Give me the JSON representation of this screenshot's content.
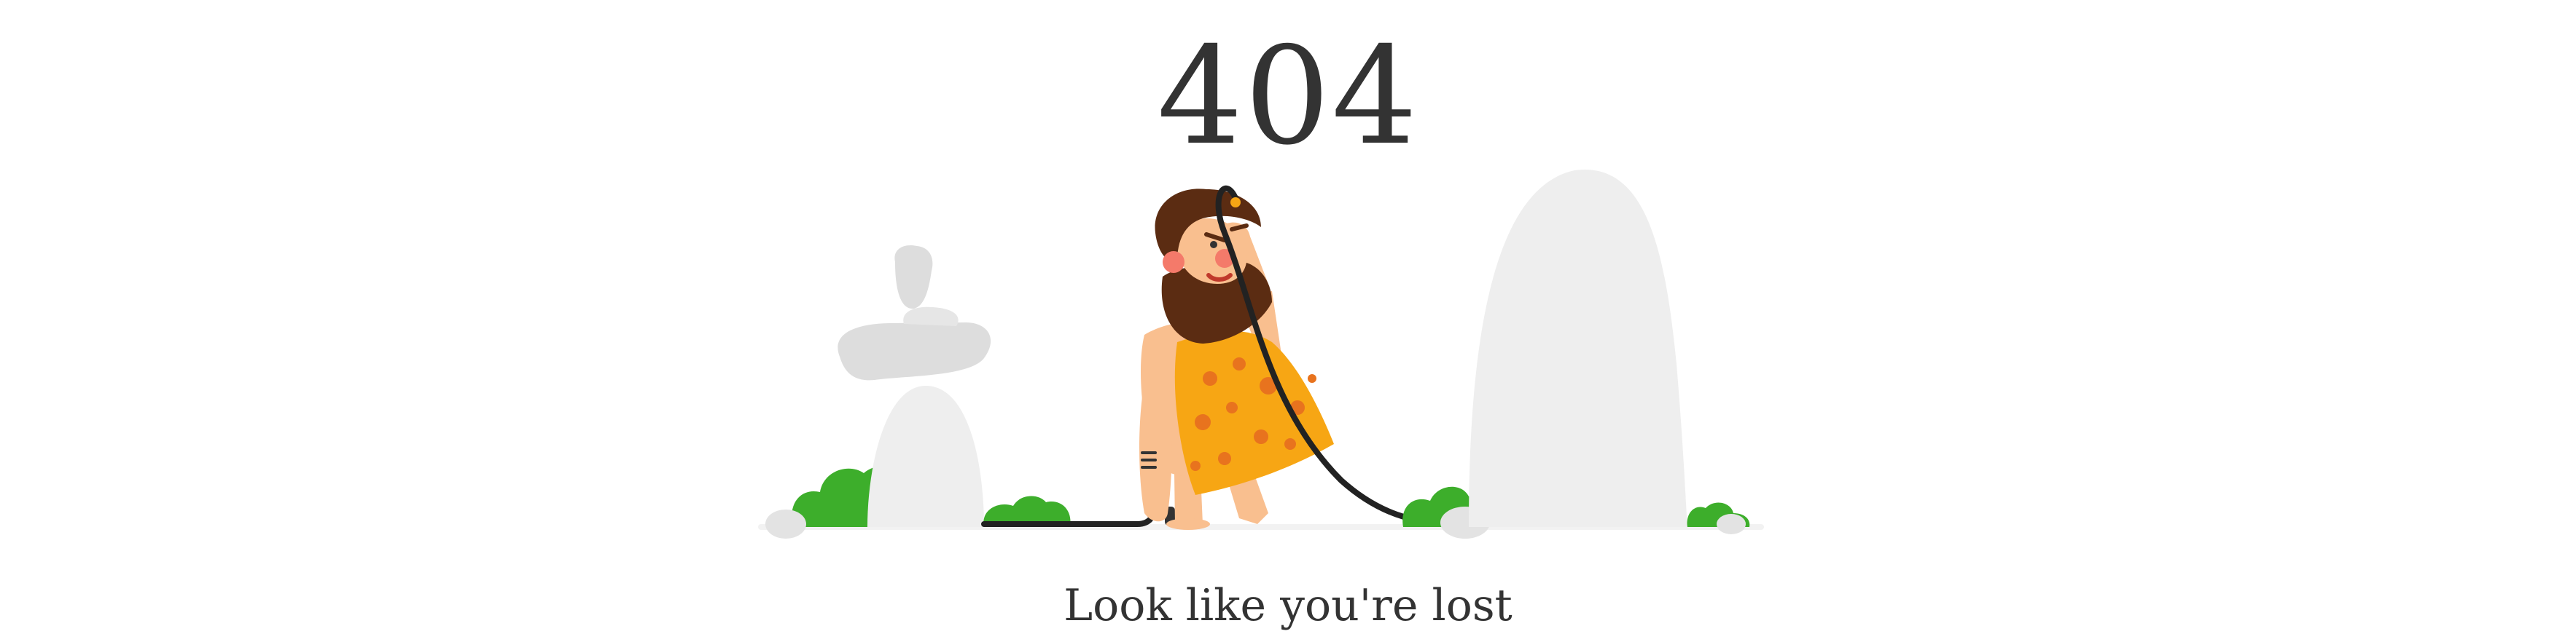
{
  "error_page": {
    "code": "404",
    "message": "Look like you're lost"
  },
  "illustration": {
    "subject": "caveman-holding-cable",
    "colors": {
      "stone_light": "#EEEEEE",
      "stone_mid": "#DDDDDD",
      "bush": "#3DAE2B",
      "skin": "#F9BF8F",
      "hair": "#5B2C12",
      "loincloth": "#F7A614",
      "spots": "#E8731E",
      "cable": "#222222",
      "ground": "#F2F2F2"
    },
    "icons": [
      "stone-cairn-icon",
      "tall-rock-icon",
      "bush-icon",
      "caveman-icon",
      "cable-icon"
    ]
  }
}
